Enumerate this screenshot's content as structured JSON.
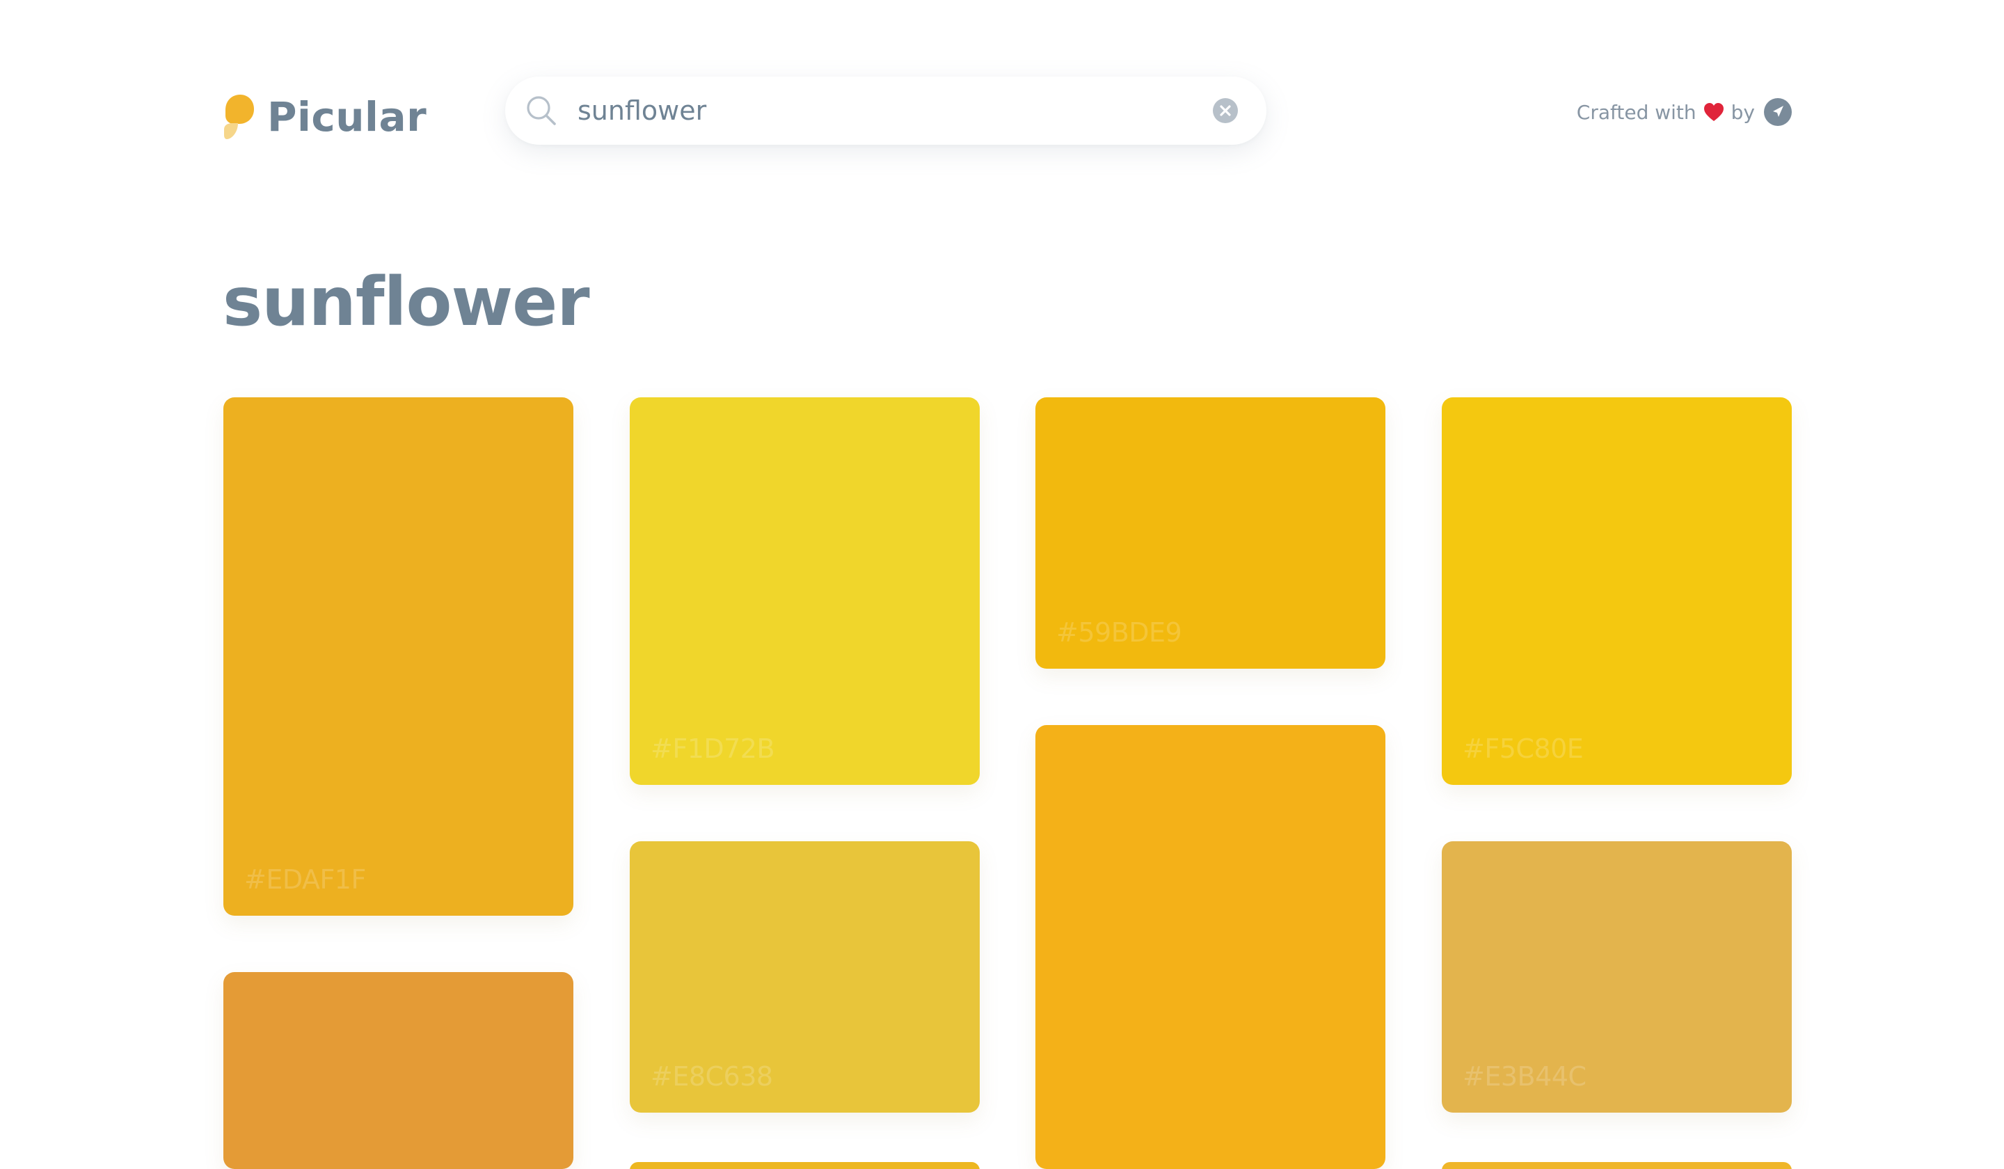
{
  "app": {
    "name": "Picular"
  },
  "search": {
    "value": "sunflower",
    "placeholder": ""
  },
  "credit": {
    "text": "Crafted with",
    "by": "by"
  },
  "title": "sunflower",
  "swatches": [
    {
      "hex": "#EDAF1F",
      "color": "#EDB020"
    },
    {
      "hex": "#F1D72B",
      "color": "#F0D62B"
    },
    {
      "hex": "#59BDE9",
      "color": "#F2B90E"
    },
    {
      "hex": "#F5C80E",
      "color": "#F4C810"
    },
    {
      "hex": "#E8C638",
      "color": "#E8C53A"
    },
    {
      "hex": "#E3B44C",
      "color": "#E3B44D"
    },
    {
      "hex": "",
      "color": "#E49B36"
    },
    {
      "hex": "",
      "color": "#F4B118"
    },
    {
      "hex": "",
      "color": "#EDB720"
    },
    {
      "hex": "",
      "color": "#EFB62A"
    }
  ],
  "colors": {
    "text": "#6F8394",
    "logo_primary": "#F2B42C",
    "logo_secondary": "#F6D68A",
    "heart": "#E0243A"
  }
}
